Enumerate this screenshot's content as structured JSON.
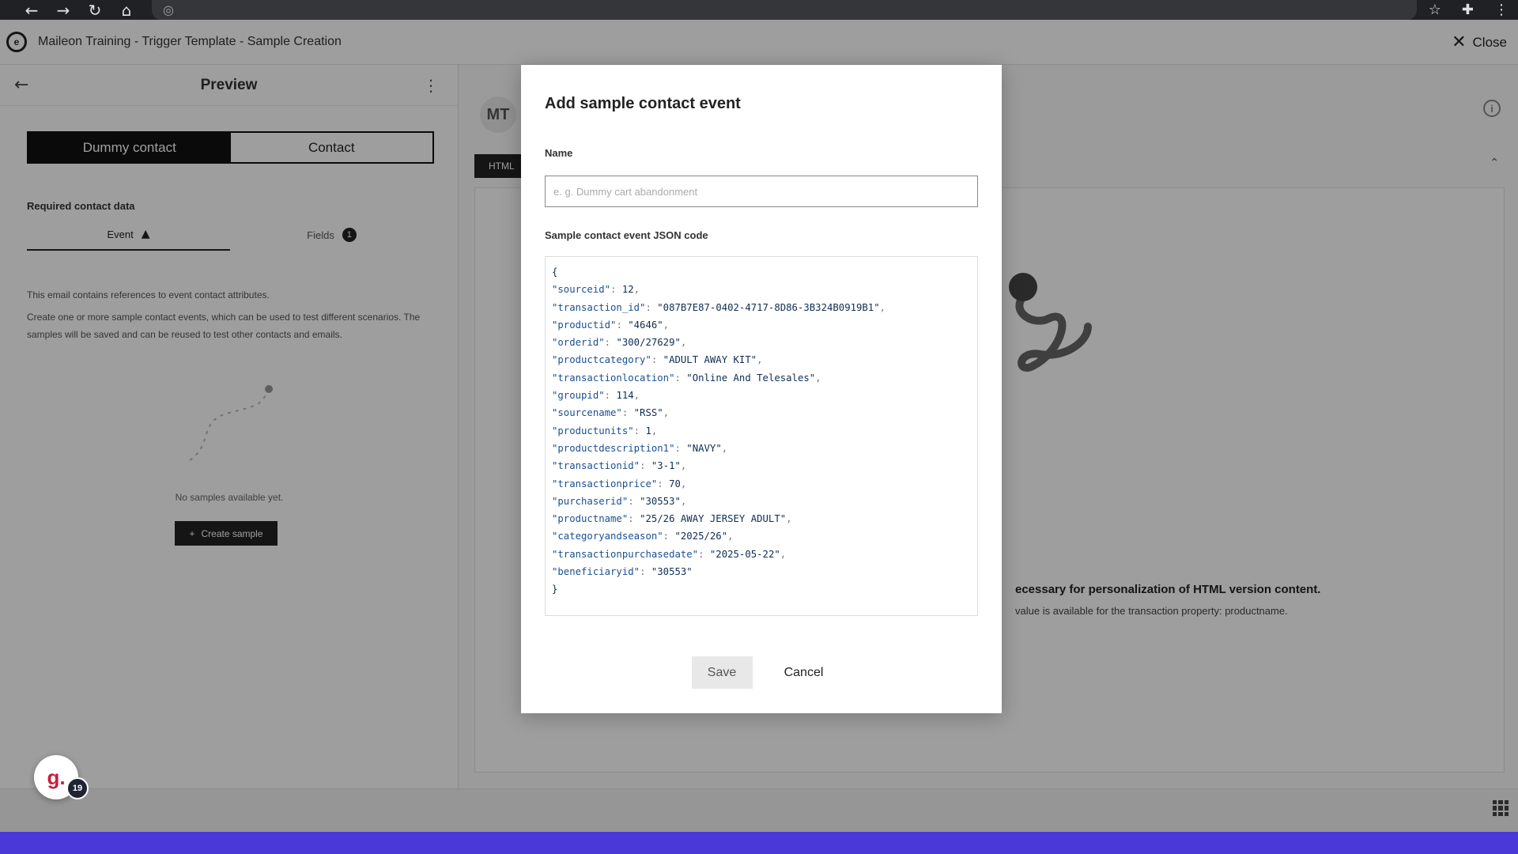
{
  "browser": {
    "back_icon": "←",
    "forward_icon": "→",
    "reload_icon": "↻",
    "home_icon": "⌂",
    "site_icon": "◎",
    "star_icon": "☆",
    "extensions_icon": "✚",
    "menu_icon": "⋮"
  },
  "app": {
    "title": "Maileon Training - Trigger Template - Sample Creation",
    "close_label": "Close",
    "close_icon": "✕"
  },
  "left_panel": {
    "title": "Preview",
    "back_icon": "←",
    "menu_icon": "⋮",
    "segments": [
      "Dummy contact",
      "Contact"
    ],
    "section_label": "Required contact data",
    "tabs": [
      {
        "label": "Event",
        "icon": "▲"
      },
      {
        "label": "Fields",
        "badge": "1"
      }
    ],
    "info_lines": [
      "This email contains references to event contact attributes.",
      "Create one or more sample contact events, which can be used to test different scenarios. The samples will be saved and can be reused to test other contacts and emails."
    ],
    "empty_text": "No samples available yet.",
    "create_button": "Create sample",
    "create_icon": "+"
  },
  "right_panel": {
    "avatar": "MT",
    "info_icon": "i",
    "tab_label": "HTML",
    "collapse_icon": "⌃",
    "message_partial": "ecessary for personalization of HTML version content.",
    "sub_partial": "value is available for the transaction property: productname."
  },
  "modal": {
    "title": "Add sample contact event",
    "name_label": "Name",
    "name_placeholder": "e. g. Dummy cart abandonment",
    "name_value": "",
    "json_label": "Sample contact event JSON code",
    "json_open": "{",
    "json_close": "}",
    "json_entries": [
      {
        "key": "sourceid",
        "value": "12",
        "sep": ","
      },
      {
        "key": "transaction_id",
        "value": "\"087B7E87-0402-4717-8D86-3B324B0919B1\"",
        "sep": ","
      },
      {
        "key": "productid",
        "value": "\"4646\"",
        "sep": ","
      },
      {
        "key": "orderid",
        "value": "\"300/27629\"",
        "sep": ","
      },
      {
        "key": "productcategory",
        "value": "\"ADULT AWAY KIT\"",
        "sep": ","
      },
      {
        "key": "transactionlocation",
        "value": "\"Online And Telesales\"",
        "sep": ","
      },
      {
        "key": "groupid",
        "value": "114",
        "sep": ","
      },
      {
        "key": "sourcename",
        "value": "\"RSS\"",
        "sep": ","
      },
      {
        "key": "productunits",
        "value": "1",
        "sep": ","
      },
      {
        "key": "productdescription1",
        "value": "\"NAVY\"",
        "sep": ","
      },
      {
        "key": "transactionid",
        "value": "\"3-1\"",
        "sep": ","
      },
      {
        "key": "transactionprice",
        "value": "70",
        "sep": ","
      },
      {
        "key": "purchaserid",
        "value": "\"30553\"",
        "sep": ","
      },
      {
        "key": "productname",
        "value": "\"25/26 AWAY JERSEY ADULT\"",
        "sep": ","
      },
      {
        "key": "categoryandseason",
        "value": "\"2025/26\"",
        "sep": ","
      },
      {
        "key": "transactionpurchasedate",
        "value": "\"2025-05-22\"",
        "sep": ","
      },
      {
        "key": "beneficiaryid",
        "value": "\"30553\"",
        "sep": ""
      }
    ],
    "save_label": "Save",
    "cancel_label": "Cancel"
  },
  "widget": {
    "logo": "g.",
    "badge": "19"
  },
  "colors": {
    "accent_dark": "#222222",
    "screen_border": "#4a39d6",
    "widget_red": "#c81e3c"
  }
}
